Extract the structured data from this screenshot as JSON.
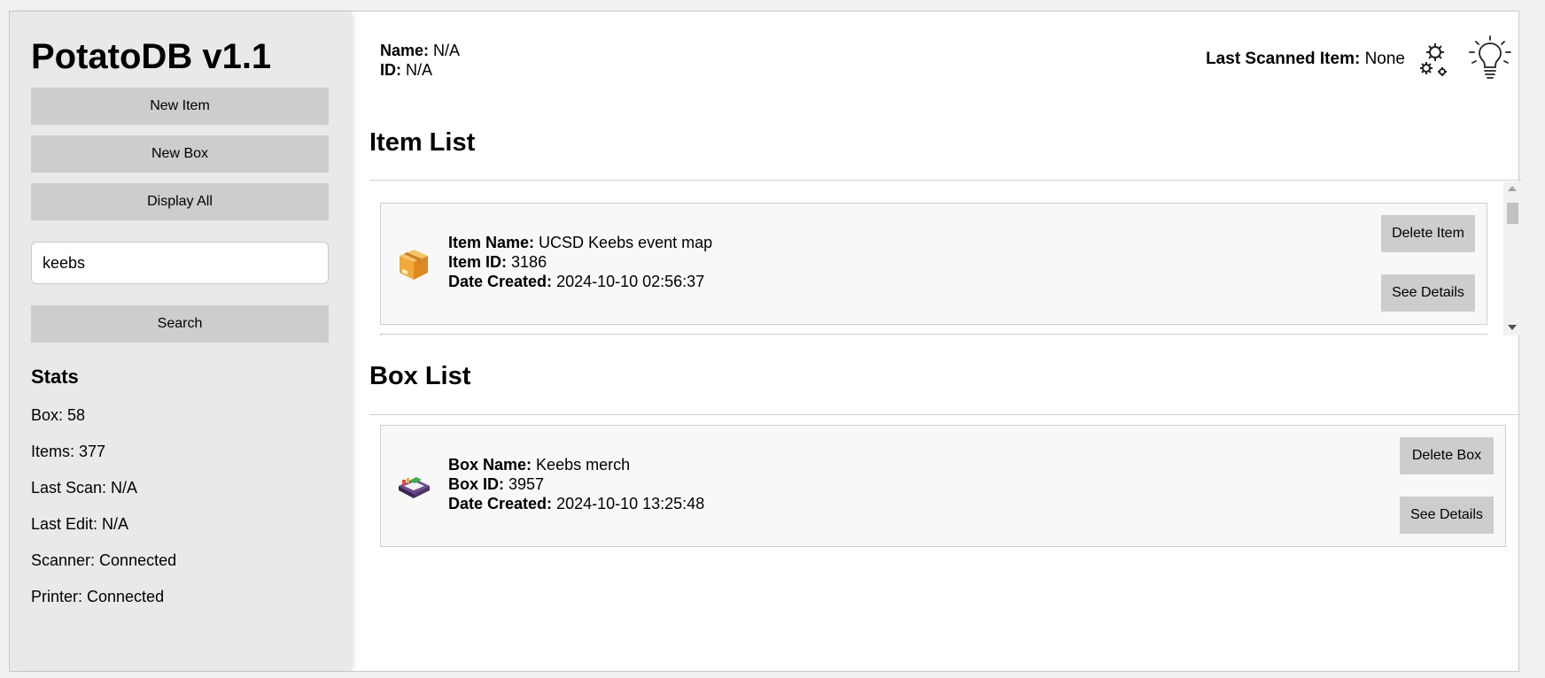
{
  "app": {
    "title": "PotatoDB v1.1"
  },
  "sidebar": {
    "new_item_label": "New Item",
    "new_box_label": "New Box",
    "display_all_label": "Display All",
    "search_value": "keebs",
    "search_label": "Search",
    "stats_title": "Stats",
    "stats": [
      "Box: 58",
      "Items: 377",
      "Last Scan: N/A",
      "Last Edit: N/A",
      "Scanner: Connected",
      "Printer: Connected"
    ]
  },
  "header": {
    "name_label": "Name:",
    "name_value": "N/A",
    "id_label": "ID:",
    "id_value": "N/A",
    "last_scanned_label": "Last Scanned Item:",
    "last_scanned_value": "None",
    "settings_icon": "gear-icon",
    "theme_icon": "lightbulb-icon"
  },
  "item_list": {
    "title": "Item List",
    "items": [
      {
        "icon": "package-icon",
        "name_label": "Item Name:",
        "name": "UCSD Keebs event map",
        "id_label": "Item ID:",
        "id": "3186",
        "date_label": "Date Created:",
        "date": "2024-10-10 02:56:37",
        "delete_label": "Delete Item",
        "details_label": "See Details"
      }
    ]
  },
  "box_list": {
    "title": "Box List",
    "boxes": [
      {
        "icon": "box-tray-icon",
        "name_label": "Box Name:",
        "name": "Keebs merch",
        "id_label": "Box ID:",
        "id": "3957",
        "date_label": "Date Created:",
        "date": "2024-10-10 13:25:48",
        "delete_label": "Delete Box",
        "details_label": "See Details"
      }
    ]
  }
}
